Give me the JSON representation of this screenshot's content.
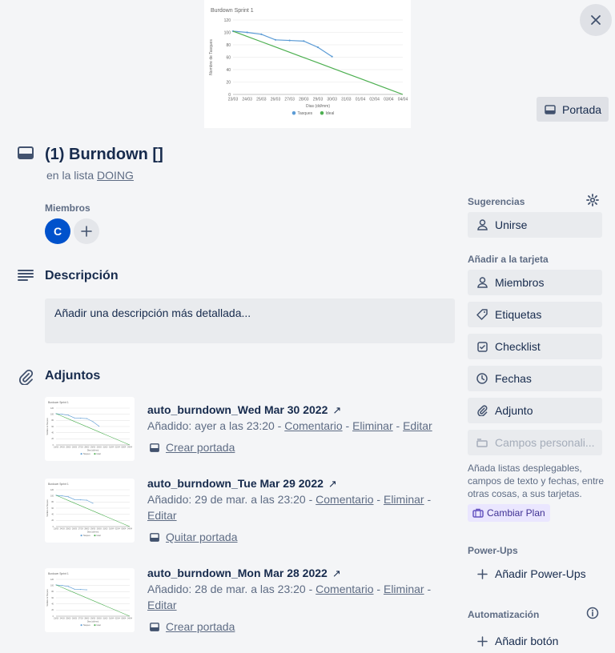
{
  "cover": {
    "chart_data": {
      "type": "line",
      "title": "Burdown Sprint 1",
      "xlabel": "Dias (dd/mm)",
      "ylabel": "Nombre de Tasques",
      "categories": [
        "23/03",
        "24/03",
        "25/03",
        "26/03",
        "27/03",
        "28/03",
        "29/03",
        "30/03",
        "31/03",
        "01/04",
        "02/04",
        "03/04",
        "04/04"
      ],
      "ylim": [
        0,
        120
      ],
      "yticks": [
        0,
        20,
        40,
        60,
        80,
        100,
        120
      ],
      "series": [
        {
          "name": "Tasques",
          "color": "#5b9bd5",
          "values": [
            102,
            100,
            97,
            88,
            87,
            86,
            76,
            61
          ]
        },
        {
          "name": "Ideal",
          "color": "#4caf50",
          "values": [
            102,
            93.5,
            85,
            76.5,
            68,
            59.5,
            51,
            42.5,
            34,
            25.5,
            17,
            8.5,
            0
          ]
        }
      ],
      "legend": "bottom",
      "grid": true
    },
    "portada_label": "Portada",
    "close_icon": "close-icon"
  },
  "card": {
    "title": "(1) Burndown []",
    "in_list_prefix": "en la lista",
    "list_name": "DOING"
  },
  "members": {
    "label": "Miembros",
    "avatar_initial": "C",
    "avatar_color": "#0052cc"
  },
  "description": {
    "title": "Descripción",
    "placeholder": "Añadir una descripción más detallada..."
  },
  "attachments": {
    "title": "Adjuntos",
    "items": [
      {
        "name": "auto_burndown_Wed Mar 30 2022",
        "added": "Añadido: ayer a las 23:20",
        "comment": "Comentario",
        "delete": "Eliminar",
        "edit": "Editar",
        "cover_action": "Crear portada"
      },
      {
        "name": "auto_burndown_Tue Mar 29 2022",
        "added": "Añadido: 29 de mar. a las 23:20",
        "comment": "Comentario",
        "delete": "Eliminar",
        "edit": "Editar",
        "cover_action": "Quitar portada"
      },
      {
        "name": "auto_burndown_Mon Mar 28 2022",
        "added": "Añadido: 28 de mar. a las 23:20",
        "comment": "Comentario",
        "delete": "Eliminar",
        "edit": "Editar",
        "cover_action": "Crear portada"
      }
    ]
  },
  "sidebar": {
    "suggestions_label": "Sugerencias",
    "join_label": "Unirse",
    "add_to_card_label": "Añadir a la tarjeta",
    "buttons": [
      {
        "label": "Miembros",
        "icon": "person-icon"
      },
      {
        "label": "Etiquetas",
        "icon": "tag-icon"
      },
      {
        "label": "Checklist",
        "icon": "checklist-icon"
      },
      {
        "label": "Fechas",
        "icon": "clock-icon"
      },
      {
        "label": "Adjunto",
        "icon": "paperclip-icon"
      },
      {
        "label": "Campos personali...",
        "icon": "custom-fields-icon"
      }
    ],
    "custom_fields_help": "Añada listas desplegables, campos de texto y fechas, entre otras cosas, a sus tarjetas.",
    "upgrade_label": "Cambiar Plan",
    "powerups_label": "Power-Ups",
    "add_powerups": "Añadir Power-Ups",
    "automation_label": "Automatización",
    "add_button": "Añadir botón"
  }
}
